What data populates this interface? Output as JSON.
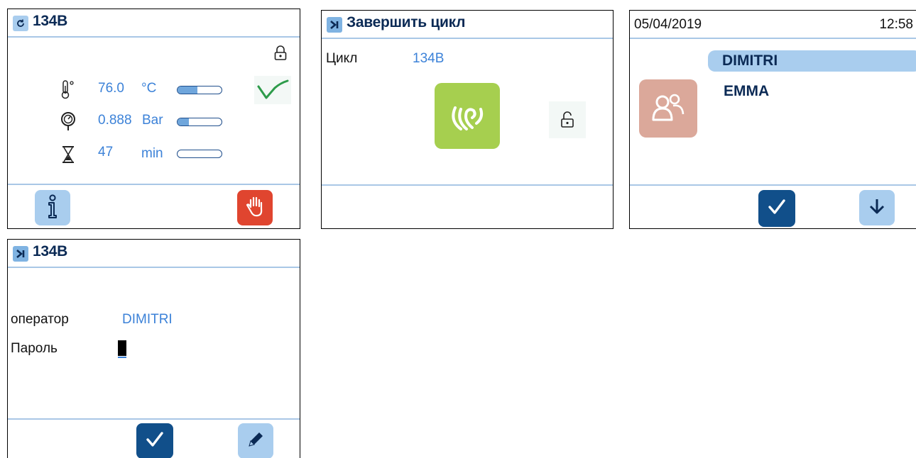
{
  "screen1": {
    "title": "134B",
    "temperature": {
      "value": "76.0",
      "unit": "°C",
      "level": 0.45
    },
    "pressure": {
      "value": "0.888",
      "unit": "Bar",
      "level": 0.25
    },
    "time": {
      "value": "47",
      "unit": "min",
      "level": 0.0
    },
    "icons": [
      "refresh-icon",
      "lock-icon",
      "thermometer-icon",
      "pressure-gauge-icon",
      "hourglass-icon",
      "wave-icon",
      "info-icon",
      "stop-hand-icon"
    ]
  },
  "screen2": {
    "title": "Завершить цикл",
    "cycle_label": "Цикл",
    "cycle_value": "134B",
    "icons": [
      "skip-icon",
      "finish-gesture-icon",
      "unlock-icon"
    ]
  },
  "screen3": {
    "date": "05/04/2019",
    "time": "12:58",
    "operators": [
      "DIMITRI",
      "EMMA"
    ],
    "selected_operator": "DIMITRI",
    "icons": [
      "users-icon",
      "confirm-icon",
      "arrow-down-icon"
    ]
  },
  "screen4": {
    "title": "134B",
    "operator_label": "оператор",
    "operator_value": "DIMITRI",
    "password_label": "Пароль",
    "icons": [
      "skip-icon",
      "confirm-icon",
      "edit-pencil-icon"
    ]
  },
  "colors": {
    "header_text": "#0b2a55",
    "value_text": "#3c82d8",
    "accent_light": "#a9cdee",
    "accent_dark": "#114f8a",
    "stop_red": "#e0452f",
    "finish_green": "#a6cf4f",
    "users_salmon": "#dba89a",
    "wave_green": "#2d9b4a"
  }
}
